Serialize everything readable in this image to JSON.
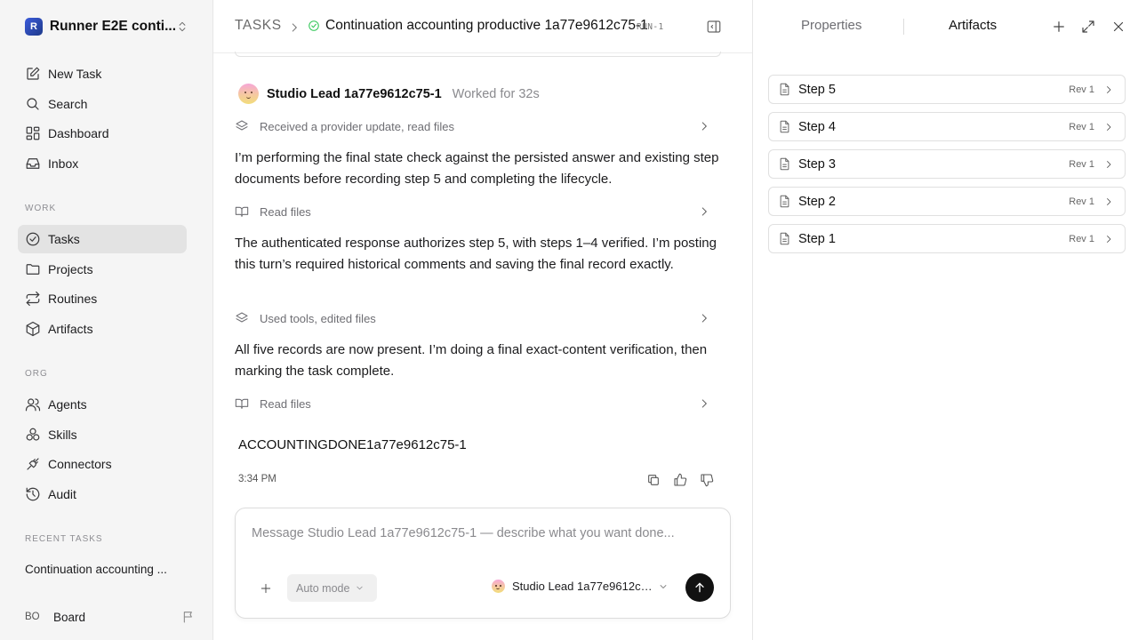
{
  "sidebar": {
    "workspace": {
      "logo_letter": "R",
      "name": "Runner E2E conti..."
    },
    "primary_nav": [
      {
        "label": "New Task",
        "icon": "edit-icon"
      },
      {
        "label": "Search",
        "icon": "search-icon"
      },
      {
        "label": "Dashboard",
        "icon": "dashboard-icon"
      },
      {
        "label": "Inbox",
        "icon": "inbox-icon"
      }
    ],
    "work_section": "WORK",
    "work_nav": [
      {
        "label": "Tasks",
        "icon": "check-circle-icon",
        "active": true
      },
      {
        "label": "Projects",
        "icon": "folder-icon"
      },
      {
        "label": "Routines",
        "icon": "repeat-icon"
      },
      {
        "label": "Artifacts",
        "icon": "cube-icon"
      }
    ],
    "org_section": "ORG",
    "org_nav": [
      {
        "label": "Agents",
        "icon": "users-icon"
      },
      {
        "label": "Skills",
        "icon": "skills-icon"
      },
      {
        "label": "Connectors",
        "icon": "plug-icon"
      },
      {
        "label": "Audit",
        "icon": "history-icon"
      }
    ],
    "recent_section": "RECENT TASKS",
    "recent_tasks": [
      "Continuation accounting ..."
    ],
    "user": {
      "initials": "BO",
      "name": "Board"
    }
  },
  "header": {
    "breadcrumb_root": "TASKS",
    "task_title": "Continuation accounting productive 1a77e9612c75-1",
    "run_badge": "RUN-1"
  },
  "conversation": {
    "author": "Studio Lead 1a77e9612c75-1",
    "worked_for": "Worked for 32s",
    "activities": [
      "Received a provider update, read files",
      "Read files",
      "Used tools, edited files",
      "Read files"
    ],
    "messages": [
      "I’m performing the final state check against the persisted answer and existing step documents before recording step 5 and completing the lifecycle.",
      "The authenticated response authorizes step 5, with steps 1–4 verified. I’m posting this turn’s required historical comments and saving the final record exactly.",
      "All five records are now present. I’m doing a final exact-content verification, then marking the task complete."
    ],
    "final_answer": "ACCOUNTINGDONE1a77e9612c75-1",
    "timestamp": "3:34 PM"
  },
  "composer": {
    "placeholder": "Message Studio Lead 1a77e9612c75-1 — describe what you want done...",
    "mode_label": "Auto mode",
    "agent_label": "Studio Lead 1a77e9612c75-1"
  },
  "right_panel": {
    "tabs": [
      "Properties",
      "Artifacts"
    ],
    "active_tab": "Artifacts",
    "artifacts": [
      {
        "name": "Step 5",
        "rev": "Rev 1"
      },
      {
        "name": "Step 4",
        "rev": "Rev 1"
      },
      {
        "name": "Step 3",
        "rev": "Rev 1"
      },
      {
        "name": "Step 2",
        "rev": "Rev 1"
      },
      {
        "name": "Step 1",
        "rev": "Rev 1"
      }
    ]
  },
  "colors": {
    "accent": "#111111",
    "status_green": "#34c759",
    "sidebar_bg": "#f5f5f5",
    "active_nav_bg": "#e3e3e3"
  }
}
